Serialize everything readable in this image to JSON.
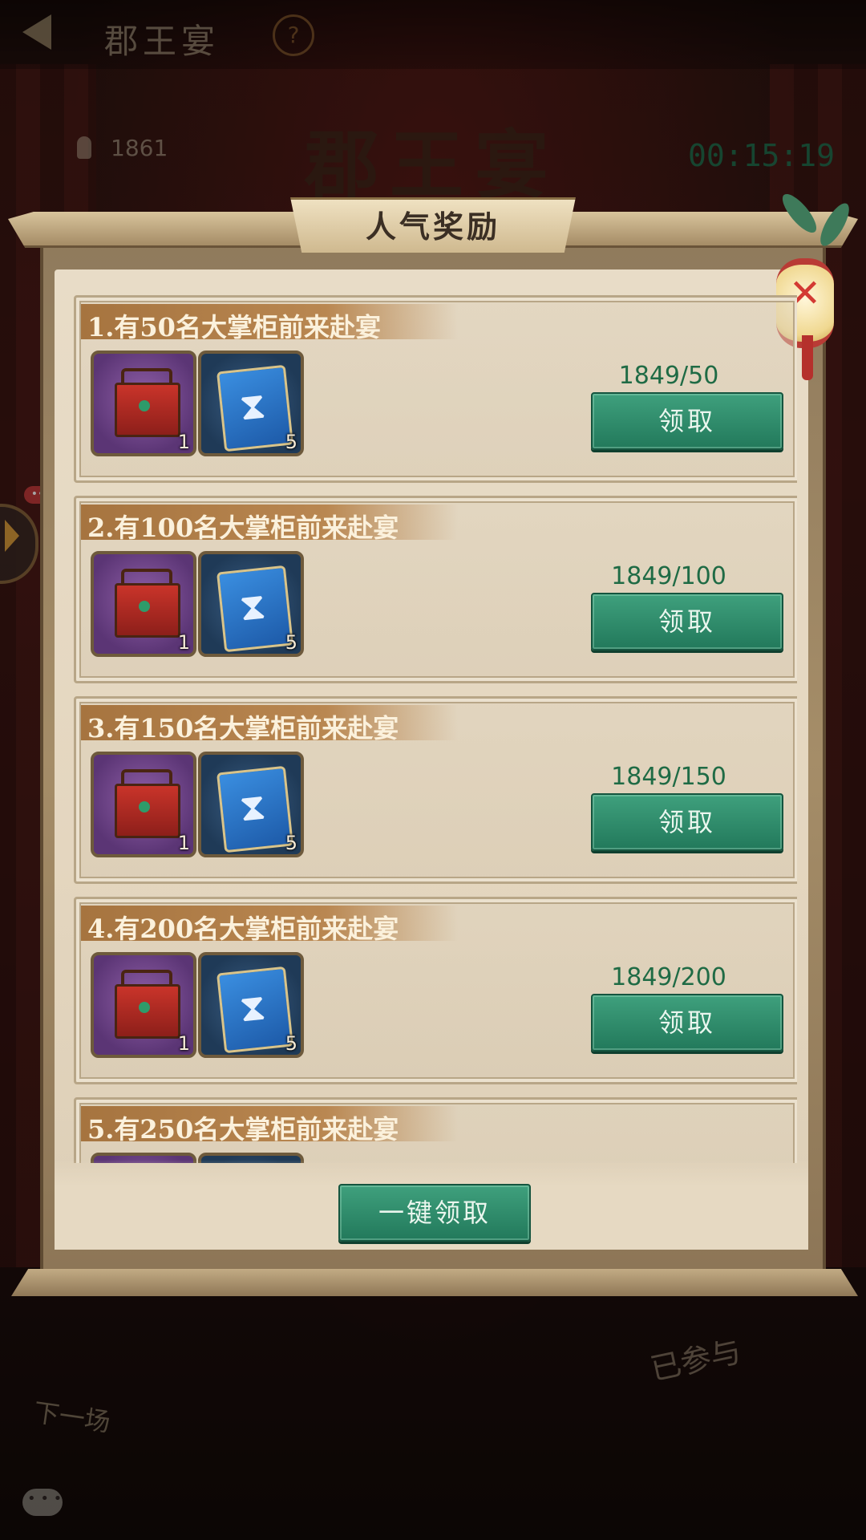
{
  "header": {
    "title": "郡王宴",
    "help_icon": "question-icon"
  },
  "scene": {
    "player_count": "1861",
    "title": "郡王宴",
    "timer": "00:15:19",
    "next_label": "下一场",
    "joined_label": "已参与"
  },
  "popup": {
    "title": "人气奖励",
    "close_icon": "close-icon",
    "claim_all_label": "一键领取",
    "rewards": [
      {
        "title": "1.有50名大掌柜前来赴宴",
        "progress": "1849/50",
        "button": "领取",
        "item1_qty": "1",
        "item2_qty": "5"
      },
      {
        "title": "2.有100名大掌柜前来赴宴",
        "progress": "1849/100",
        "button": "领取",
        "item1_qty": "1",
        "item2_qty": "5"
      },
      {
        "title": "3.有150名大掌柜前来赴宴",
        "progress": "1849/150",
        "button": "领取",
        "item1_qty": "1",
        "item2_qty": "5"
      },
      {
        "title": "4.有200名大掌柜前来赴宴",
        "progress": "1849/200",
        "button": "领取",
        "item1_qty": "1",
        "item2_qty": "5"
      },
      {
        "title": "5.有250名大掌柜前来赴宴",
        "progress": "",
        "button": "",
        "item1_qty": "",
        "item2_qty": ""
      }
    ]
  },
  "colors": {
    "accent_green": "#22795b",
    "progress_text": "#1f6b45",
    "ribbon": "#a6743f"
  }
}
